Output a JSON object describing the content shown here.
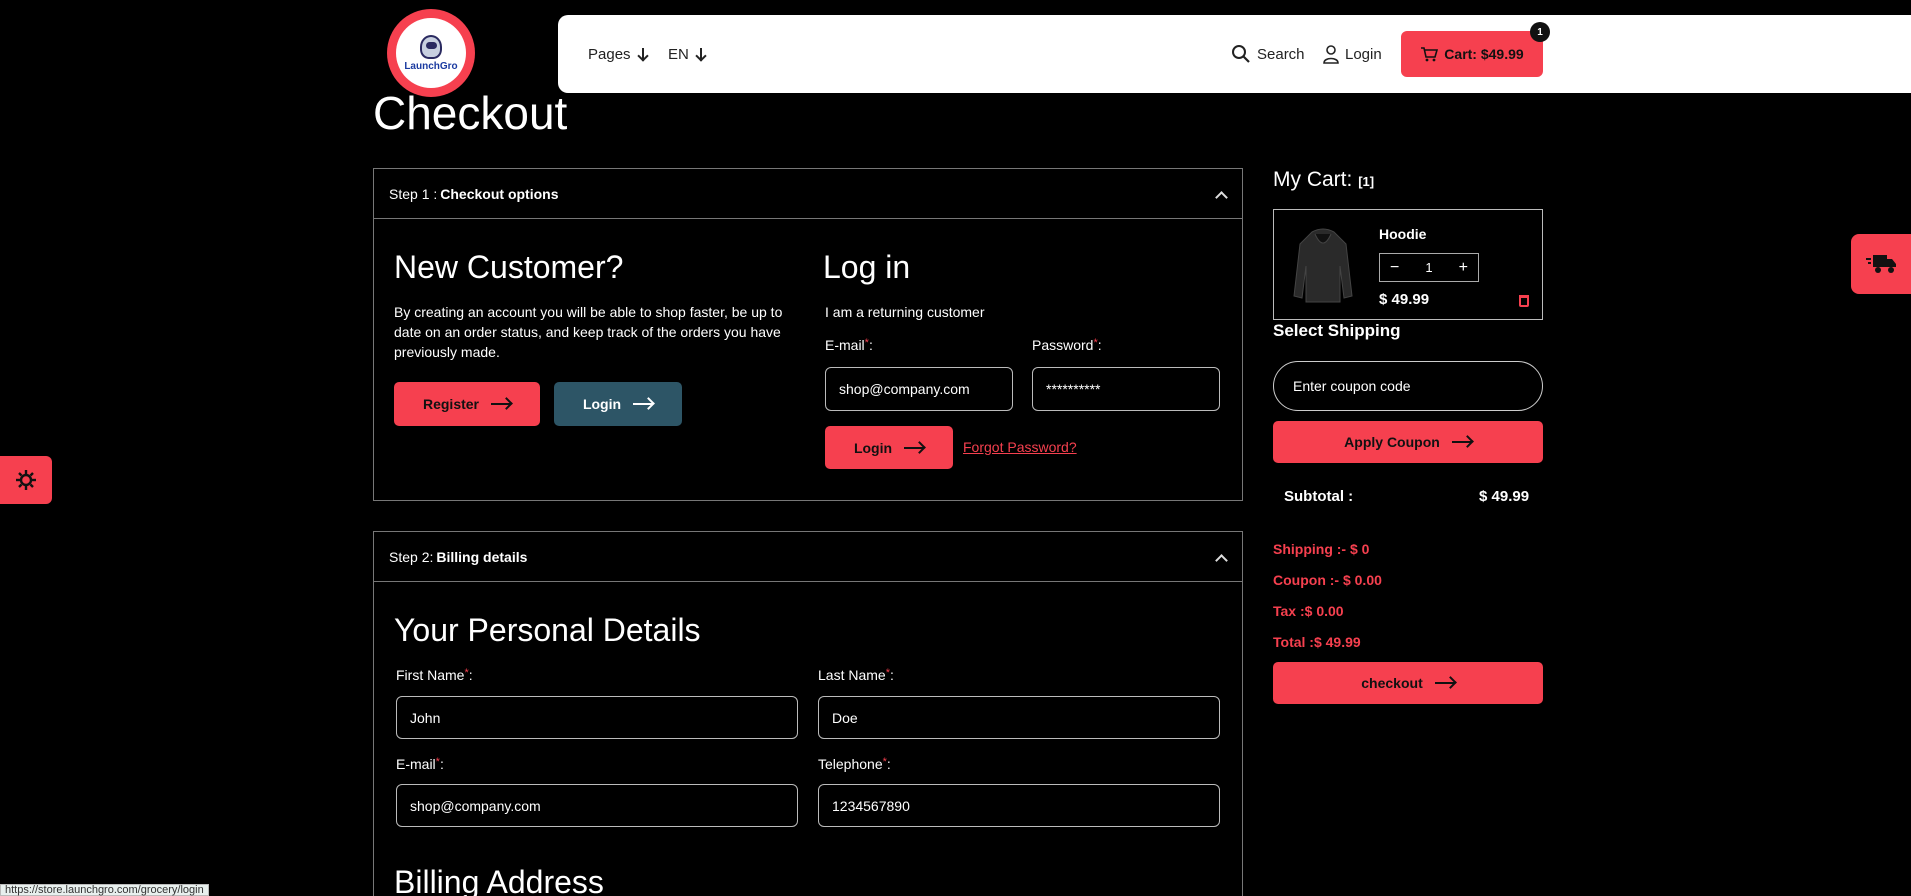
{
  "header": {
    "logo_text": "LaunchGro",
    "nav": {
      "pages_label": "Pages",
      "lang_label": "EN",
      "search_label": "Search",
      "login_label": "Login"
    },
    "cart": {
      "label": "Cart: $49.99",
      "count": "1"
    }
  },
  "page": {
    "title": "Checkout"
  },
  "step1": {
    "prefix": "Step 1 :",
    "title": "Checkout options",
    "new_customer": {
      "heading": "New Customer?",
      "text": "By creating an account you will be able to shop faster, be up to date on an order status, and keep track of the orders you have previously made.",
      "register_label": "Register",
      "login_label": "Login"
    },
    "login": {
      "heading": "Log in",
      "subtext": "I am a returning customer",
      "email_label": "E-mail",
      "email_value": "shop@company.com",
      "password_label": "Password",
      "password_value": "**********",
      "login_label": "Login",
      "forgot_label": "Forgot Password?"
    }
  },
  "step2": {
    "prefix": "Step 2:",
    "title": "Billing details",
    "personal_heading": "Your Personal Details",
    "first_name_label": "First Name",
    "first_name_value": "John",
    "last_name_label": "Last Name",
    "last_name_value": "Doe",
    "email_label": "E-mail",
    "email_value": "shop@company.com",
    "telephone_label": "Telephone",
    "telephone_value": "1234567890",
    "billing_heading": "Billing Address"
  },
  "sidebar": {
    "my_cart_label": "My Cart:",
    "my_cart_count": "[1]",
    "item": {
      "name": "Hoodie",
      "qty": "1",
      "price": "$ 49.99"
    },
    "select_shipping": "Select Shipping",
    "coupon_placeholder": "Enter coupon code",
    "apply_coupon_label": "Apply Coupon",
    "subtotal_label": "Subtotal :",
    "subtotal_value": "$ 49.99",
    "shipping": "Shipping :- $ 0",
    "coupon": "Coupon :- $ 0.00",
    "tax": "Tax :$ 0.00",
    "total": "Total :$ 49.99",
    "checkout_label": "checkout"
  },
  "status_bar": {
    "url": "https://store.launchgro.com/grocery/login"
  },
  "colors": {
    "accent": "#f6404f",
    "slate": "#2d5566",
    "background": "#000000"
  }
}
